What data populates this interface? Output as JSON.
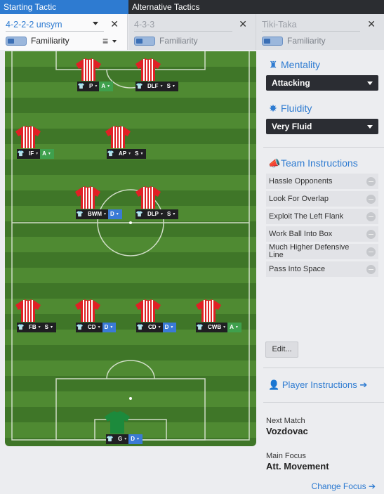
{
  "tabs": {
    "starting": "Starting Tactic",
    "alternative": "Alternative Tactics"
  },
  "tactics": [
    {
      "name": "4-2-2-2 unsym",
      "familiarity": "Familiarity"
    },
    {
      "name": "4-3-3",
      "familiarity": "Familiarity"
    },
    {
      "name": "Tiki-Taka",
      "familiarity": "Familiarity"
    }
  ],
  "colors": {
    "accent": "#2e7bd1",
    "attack": "#3fa04d",
    "defend": "#3a7ad6",
    "support": "#1f1f22"
  },
  "players": [
    {
      "role": "P",
      "duty": "A"
    },
    {
      "role": "DLF",
      "duty": "S"
    },
    {
      "role": "IF",
      "duty": "A"
    },
    {
      "role": "AP",
      "duty": "S"
    },
    {
      "role": "BWM",
      "duty": "D"
    },
    {
      "role": "DLP",
      "duty": "S"
    },
    {
      "role": "FB",
      "duty": "S"
    },
    {
      "role": "CD",
      "duty": "D"
    },
    {
      "role": "CD",
      "duty": "D"
    },
    {
      "role": "CWB",
      "duty": "A"
    },
    {
      "role": "G",
      "duty": "D"
    }
  ],
  "sidebar": {
    "mentality": {
      "title": "Mentality",
      "value": "Attacking"
    },
    "fluidity": {
      "title": "Fluidity",
      "value": "Very Fluid"
    },
    "team_instructions": {
      "title": "Team Instructions",
      "items": [
        "Hassle Opponents",
        "Look For Overlap",
        "Exploit The Left Flank",
        "Work Ball Into Box",
        "Much Higher Defensive Line",
        "Pass Into Space"
      ],
      "edit": "Edit..."
    },
    "player_instructions": "Player Instructions",
    "next_match": {
      "label": "Next Match",
      "value": "Vozdovac"
    },
    "main_focus": {
      "label": "Main Focus",
      "value": "Att. Movement"
    },
    "change_focus": "Change Focus"
  }
}
